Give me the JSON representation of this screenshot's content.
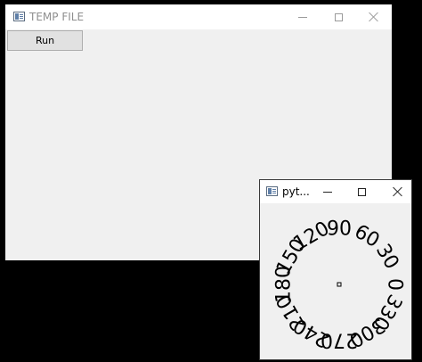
{
  "main_window": {
    "title": "TEMP FILE",
    "run_label": "Run"
  },
  "plot_window": {
    "title": "pyt..."
  },
  "dial": {
    "labels": [
      "0",
      "30",
      "60",
      "90",
      "120",
      "150",
      "180",
      "210",
      "240",
      "270",
      "300",
      "330"
    ],
    "text_color": "#000000"
  }
}
